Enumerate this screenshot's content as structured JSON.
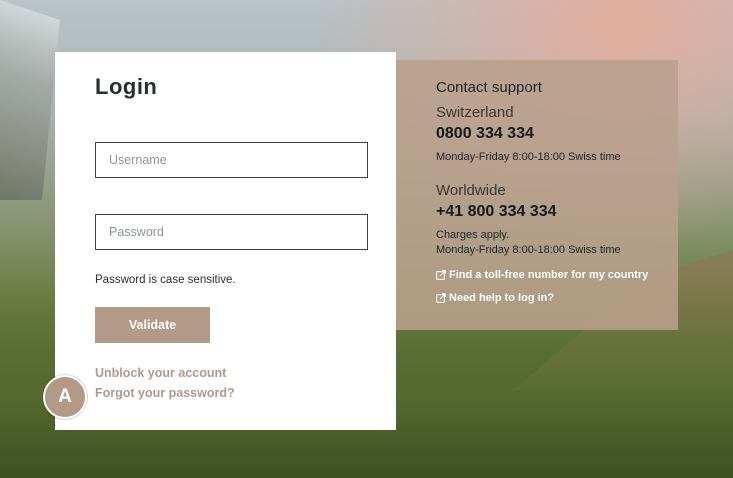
{
  "login": {
    "title": "Login",
    "username_placeholder": "Username",
    "password_placeholder": "Password",
    "hint": "Password is case sensitive.",
    "validate_label": "Validate",
    "unblock_link": "Unblock your account",
    "forgot_link": "Forgot your password?"
  },
  "avatar": {
    "initial": "A"
  },
  "support": {
    "heading": "Contact support",
    "regions": [
      {
        "name": "Switzerland",
        "phone": "0800 334 334",
        "note": "",
        "hours": "Monday-Friday 8:00-18:00 Swiss time"
      },
      {
        "name": "Worldwide",
        "phone": "+41 800 334 334",
        "note": "Charges apply.",
        "hours": "Monday-Friday 8:00-18:00 Swiss time"
      }
    ],
    "links": [
      {
        "label": "Find a toll-free number for my country",
        "icon": "external-link-icon"
      },
      {
        "label": "Need help to log in?",
        "icon": "external-link-icon"
      }
    ]
  },
  "colors": {
    "accent": "#b39a87",
    "panel": "#b9a08c",
    "text": "#2a2e33"
  }
}
